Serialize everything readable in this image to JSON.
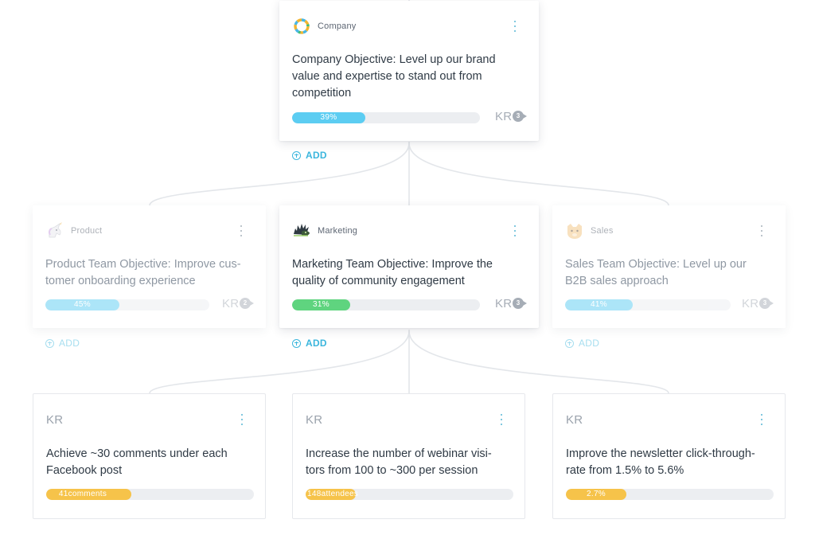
{
  "colors": {
    "blue": "#5ccdf2",
    "light_blue": "#9fe0f5",
    "green": "#5fd47f",
    "yellow": "#f6c34a",
    "accent": "#3bb6dd"
  },
  "company_card": {
    "team": "Company",
    "avatar_icon": "company-ring-logo-icon",
    "title_lines": [
      "Company Objective: Level up our brand",
      "value and expertise to stand out from",
      "competition"
    ],
    "progress_label": "39%",
    "progress": 0.39,
    "kr_label": "KR",
    "kr_count": "3",
    "add_label": "ADD"
  },
  "team_cards": [
    {
      "team": "Product",
      "avatar_icon": "unicorn-avatar-icon",
      "title_lines": [
        "Product Team Objective: Improve cus-",
        "tomer onboarding experience"
      ],
      "progress_label": "45%",
      "progress": 0.45,
      "kr_label": "KR",
      "kr_count": "2",
      "add_label": "ADD"
    },
    {
      "team": "Marketing",
      "avatar_icon": "hedgehog-avatar-icon",
      "title_lines": [
        "Marketing Team Objective: Improve the",
        "quality of community engagement"
      ],
      "progress_label": "31%",
      "progress": 0.31,
      "kr_label": "KR",
      "kr_count": "3",
      "add_label": "ADD"
    },
    {
      "team": "Sales",
      "avatar_icon": "cat-avatar-icon",
      "title_lines": [
        "Sales Team Objective: Level up our",
        "B2B sales approach"
      ],
      "progress_label": "41%",
      "progress": 0.41,
      "kr_label": "KR",
      "kr_count": "3",
      "add_label": "ADD"
    }
  ],
  "kr_cards": [
    {
      "label": "KR",
      "title_lines": [
        "Achieve ~30 comments under each",
        "Facebook post"
      ],
      "progress_label": "41comments",
      "progress": 0.41
    },
    {
      "label": "KR",
      "title_lines": [
        "Increase the number of webinar visi-",
        "tors from 100 to ~300 per session"
      ],
      "progress_label": "148attendees",
      "progress": 0.24
    },
    {
      "label": "KR",
      "title_lines": [
        "Improve the newsletter click-through-",
        "rate from 1.5% to 5.6%"
      ],
      "progress_label": "2.7%",
      "progress": 0.29
    }
  ]
}
